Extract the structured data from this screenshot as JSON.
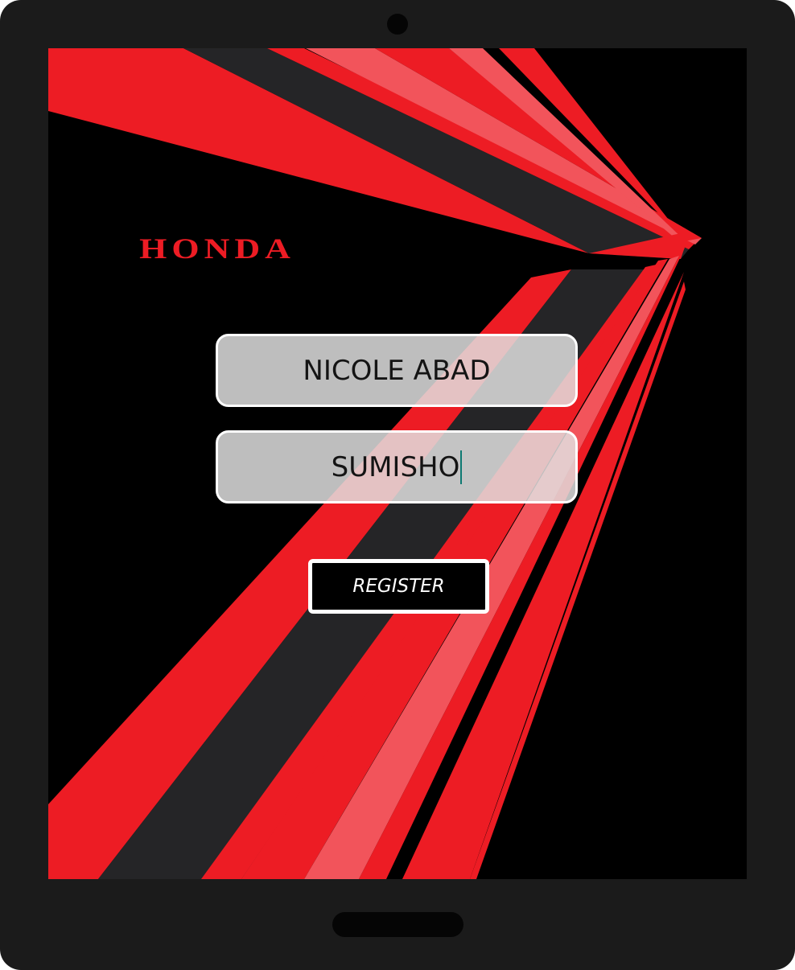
{
  "brand": {
    "logo_text": "HONDA",
    "logo_color": "#ED1C24"
  },
  "form": {
    "name_value": "NICOLE ABAD",
    "company_value": "SUMISHO",
    "register_label": "REGISTER"
  },
  "colors": {
    "device_frame": "#1B1B1B",
    "screen_background": "#000000",
    "accent_red": "#ED1C24",
    "stripe_light_red": "#F2545B",
    "stripe_dark": "#252527",
    "field_background": "#E2E2E2",
    "caret": "#0F7A73"
  }
}
